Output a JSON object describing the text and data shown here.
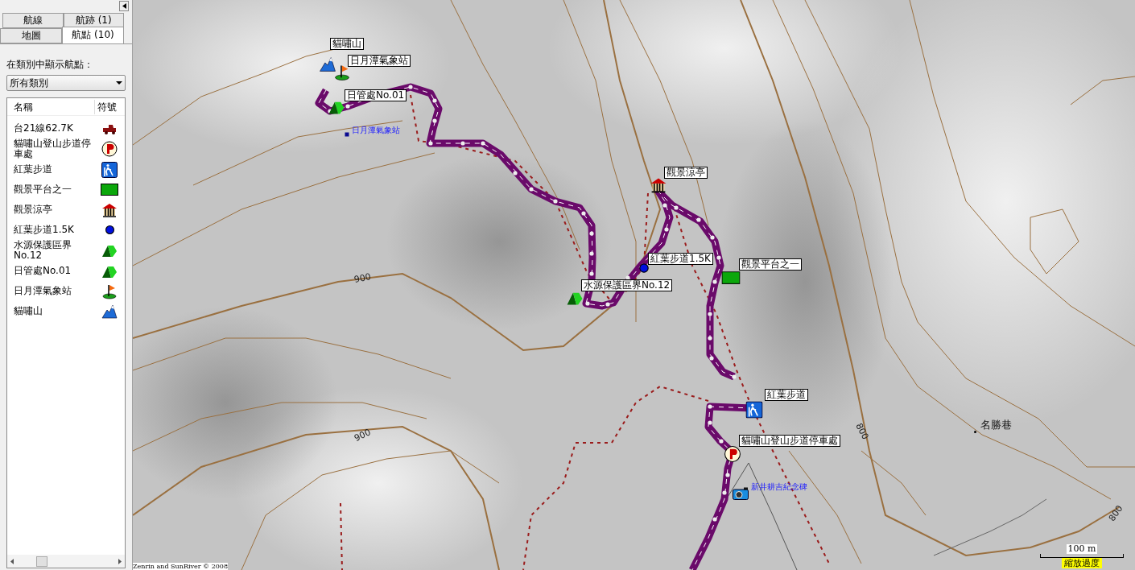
{
  "panel": {
    "tab_rows": [
      [
        {
          "label": "航線",
          "selected": false
        },
        {
          "label": "航跡 (1)",
          "selected": false
        }
      ],
      [
        {
          "label": "地圖",
          "selected": false
        },
        {
          "label": "航點 (10)",
          "selected": true
        }
      ]
    ],
    "filter_label": "在類別中顯示航點：",
    "category_dropdown": {
      "value": "所有類別"
    },
    "list": {
      "columns": [
        "名稱",
        "符號"
      ],
      "rows": [
        {
          "name": "台21線62.7K",
          "kind": "car"
        },
        {
          "name": "貓嘯山登山步道停車處",
          "kind": "parking"
        },
        {
          "name": "紅葉步道",
          "kind": "hiker"
        },
        {
          "name": "觀景平台之一",
          "kind": "rect"
        },
        {
          "name": "觀景涼亭",
          "kind": "pavilion"
        },
        {
          "name": "紅葉步道1.5K",
          "kind": "dot"
        },
        {
          "name": "水源保護區界No.12",
          "kind": "tent"
        },
        {
          "name": "日管處No.01",
          "kind": "tent"
        },
        {
          "name": "日月潭氣象站",
          "kind": "flag"
        },
        {
          "name": "貓嘯山",
          "kind": "mountain"
        }
      ]
    }
  },
  "map": {
    "waypoints": [
      {
        "label": "貓嘯山",
        "kind": "mountain"
      },
      {
        "label": "日月潭氣象站",
        "kind": "flag"
      },
      {
        "label": "日管處No.01",
        "kind": "tent"
      },
      {
        "label": "觀景涼亭",
        "kind": "pavilion"
      },
      {
        "label": "紅葉步道1.5K",
        "kind": "dot"
      },
      {
        "label": "觀景平台之一",
        "kind": "rect"
      },
      {
        "label": "水源保護區界No.12",
        "kind": "tent"
      },
      {
        "label": "紅葉步道",
        "kind": "hiker"
      },
      {
        "label": "貓嘯山登山步道停車處",
        "kind": "parking"
      }
    ],
    "points": [
      {
        "label": "日月潭氣象站",
        "kind": "square"
      },
      {
        "label": "新井耕吉紀念碑",
        "kind": "camera"
      }
    ],
    "contour_labels": [
      "900",
      "900",
      "800",
      "800"
    ],
    "places": [
      {
        "label": "名勝巷"
      }
    ],
    "scale": {
      "distance": "100 m",
      "zoom_note": "縮放過度"
    },
    "copyright": "Zenrin and SunRiver © 2008"
  }
}
